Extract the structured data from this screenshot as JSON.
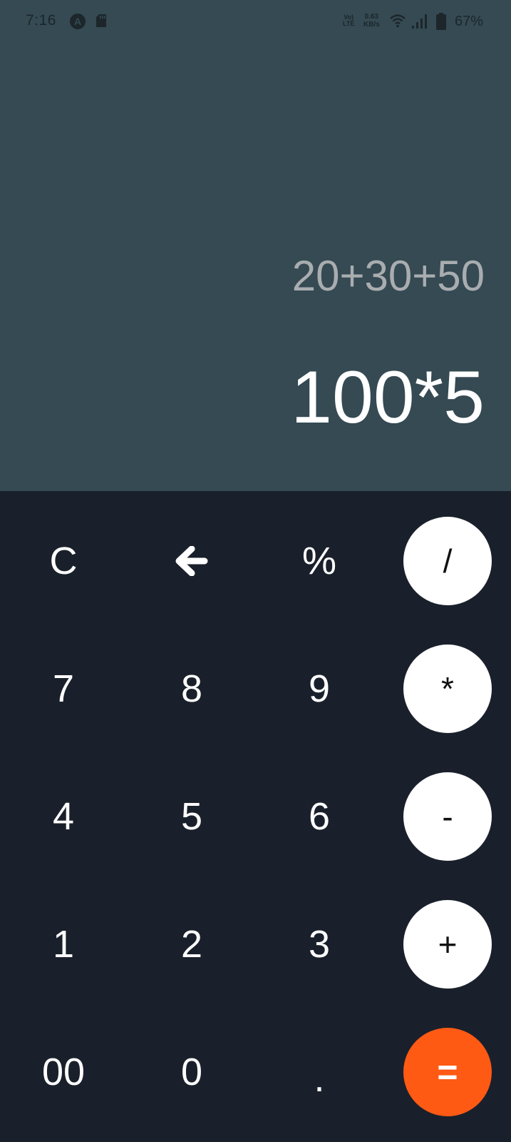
{
  "status_bar": {
    "time": "7:16",
    "a_icon_letter": "A",
    "volte_top": "Vo)",
    "volte_bottom": "LTE",
    "speed_value": "0.63",
    "speed_unit": "KB/s",
    "battery_percent": "67%"
  },
  "display": {
    "expression": "20+30+50",
    "result": "100*5"
  },
  "keypad": {
    "clear": "C",
    "backspace_icon": "arrow-left-icon",
    "percent": "%",
    "divide": "/",
    "seven": "7",
    "eight": "8",
    "nine": "9",
    "multiply": "*",
    "four": "4",
    "five": "5",
    "six": "6",
    "minus": "-",
    "one": "1",
    "two": "2",
    "three": "3",
    "plus": "+",
    "double_zero": "00",
    "zero": "0",
    "decimal": ".",
    "equals": "="
  },
  "colors": {
    "display_background": "#354a53",
    "keypad_background": "#1a202b",
    "operator_button": "#ffffff",
    "equals_button": "#ff5a14",
    "expression_text": "#a9adaf"
  }
}
